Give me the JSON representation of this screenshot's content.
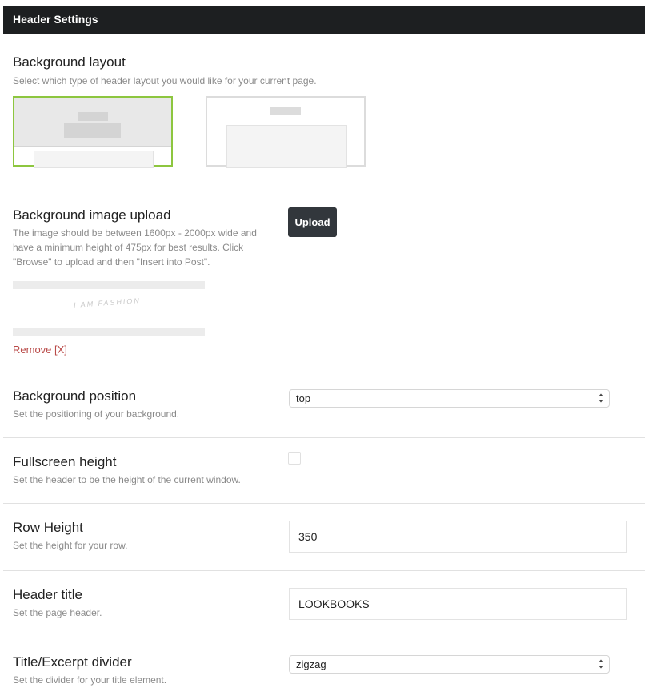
{
  "header": {
    "title": "Header Settings"
  },
  "background_layout": {
    "title": "Background layout",
    "description": "Select which type of header layout you would like for your current page.",
    "selected_option": 1,
    "accent_color": "#8dc63f"
  },
  "background_image": {
    "title": "Background image upload",
    "description": "The image should be between 1600px - 2000px wide and have a minimum height of 475px for best results. Click \"Browse\" to upload and then \"Insert into Post\".",
    "upload_label": "Upload",
    "preview_text": "I AM FASHION",
    "remove_label": "Remove [X]"
  },
  "background_position": {
    "title": "Background position",
    "description": "Set the positioning of your background.",
    "selected_value": "top"
  },
  "fullscreen_height": {
    "title": "Fullscreen height",
    "description": "Set the header to be the height of the current window.",
    "checked": false
  },
  "row_height": {
    "title": "Row Height",
    "description": "Set the height for your row.",
    "value": "350"
  },
  "header_title": {
    "title": "Header title",
    "description": "Set the page header.",
    "value": "LOOKBOOKS"
  },
  "title_divider": {
    "title": "Title/Excerpt divider",
    "description": "Set the divider for your title element.",
    "selected_value": "zigzag"
  }
}
